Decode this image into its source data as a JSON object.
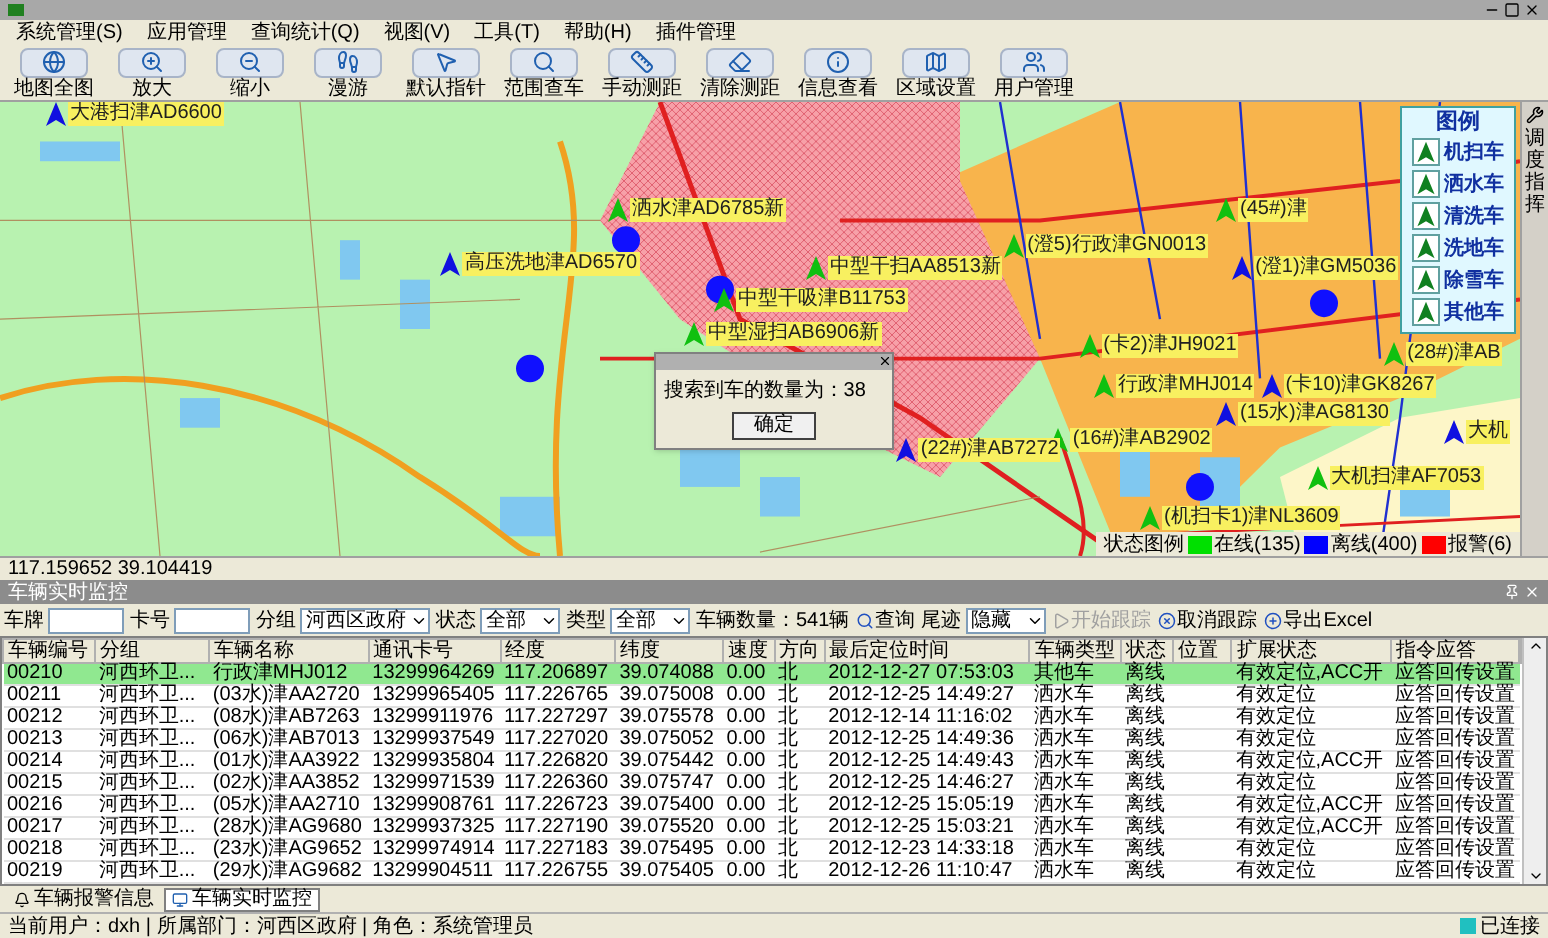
{
  "menu": [
    "系统管理(S)",
    "应用管理",
    "查询统计(Q)",
    "视图(V)",
    "工具(T)",
    "帮助(H)",
    "插件管理"
  ],
  "toolbar": [
    "地图全图",
    "放大",
    "缩小",
    "漫游",
    "默认指针",
    "范围查车",
    "手动测距",
    "清除测距",
    "信息查看",
    "区域设置",
    "用户管理"
  ],
  "map": {
    "vehicles": [
      {
        "label": "大港扫津AD6600",
        "color": "#1010e0"
      },
      {
        "label": "洒水津AD6785新",
        "color": "#10c010"
      },
      {
        "label": "(45#)津",
        "color": "#10c010"
      },
      {
        "label": "(澄5)行政津GN0013",
        "color": "#10c010"
      },
      {
        "label": "高压洗地津AD6570",
        "color": "#1010e0"
      },
      {
        "label": "中型干扫AA8513新",
        "color": "#10c010"
      },
      {
        "label": "(澄1)津GM5036",
        "color": "#1010e0"
      },
      {
        "label": "中型干吸津B11753",
        "color": "#10c010"
      },
      {
        "label": "中型湿扫AB6906新",
        "color": "#10c010"
      },
      {
        "label": "(卡2)津JH9021",
        "color": "#10c010"
      },
      {
        "label": "(28#)津AB",
        "color": "#10c010"
      },
      {
        "label": "行政津MHJ014",
        "color": "#10c010"
      },
      {
        "label": "(卡10)津GK8267",
        "color": "#1010e0"
      },
      {
        "label": "(15水)津AG8130",
        "color": "#1010e0"
      },
      {
        "label": "大机",
        "color": "#1010e0"
      },
      {
        "label": "(16#)津AB2902",
        "color": "#10c010"
      },
      {
        "label": "(22#)津AB7272",
        "color": "#1010e0"
      },
      {
        "label": "大机扫津AF7053",
        "color": "#10c010"
      },
      {
        "label": "(机扫卡1)津NL3609",
        "color": "#10c010"
      }
    ],
    "legend": {
      "title": "图例",
      "items": [
        "机扫车",
        "洒水车",
        "清洗车",
        "洗地车",
        "除雪车",
        "其他车"
      ]
    },
    "dialog": {
      "message": "搜索到车的数量为：38",
      "button": "确定"
    },
    "status_legend": {
      "label": "状态图例",
      "items": [
        {
          "label": "在线(135)",
          "color": "#00e000"
        },
        {
          "label": "离线(400)",
          "color": "#0000ff"
        },
        {
          "label": "报警(6)",
          "color": "#ff0000"
        }
      ]
    }
  },
  "side_tab": "调度指挥",
  "coordinates": "117.159652 39.104419",
  "monitor": {
    "title": "车辆实时监控",
    "filters": [
      {
        "kind": "input",
        "label": "车牌"
      },
      {
        "kind": "input",
        "label": "卡号"
      },
      {
        "kind": "select",
        "label": "分组",
        "value": "河西区政府"
      },
      {
        "kind": "select",
        "label": "状态",
        "value": "全部"
      },
      {
        "kind": "select",
        "label": "类型",
        "value": "全部"
      },
      {
        "kind": "text",
        "label": "车辆数量：541辆"
      },
      {
        "kind": "button",
        "label": "查询",
        "disabled": false
      },
      {
        "kind": "select",
        "label": "尾迹",
        "value": "隐藏"
      },
      {
        "kind": "button",
        "label": "开始跟踪",
        "disabled": true
      },
      {
        "kind": "button",
        "label": "取消跟踪",
        "disabled": false
      },
      {
        "kind": "button",
        "label": "导出Excel",
        "disabled": false
      }
    ],
    "columns": [
      "车辆编号",
      "分组",
      "车辆名称",
      "通讯卡号",
      "经度",
      "纬度",
      "速度",
      "方向",
      "最后定位时间",
      "车辆类型",
      "状态",
      "位置",
      "扩展状态",
      "指令应答"
    ],
    "rows": [
      {
        "id": "00210",
        "group": "河西环卫...",
        "name": "行政津MHJ012",
        "card": "13299964269",
        "lon": "117.206897",
        "lat": "39.074088",
        "speed": "0.00",
        "dir": "北",
        "time": "2012-12-27 07:53:03",
        "type": "其他车",
        "status": "离线",
        "ext": "有效定位,ACC开",
        "ack": "应答回传设置",
        "selected": true
      },
      {
        "id": "00211",
        "group": "河西环卫...",
        "name": "(03水)津AA2720",
        "card": "13299965405",
        "lon": "117.226765",
        "lat": "39.075008",
        "speed": "0.00",
        "dir": "北",
        "time": "2012-12-25 14:49:27",
        "type": "洒水车",
        "status": "离线",
        "ext": "有效定位",
        "ack": "应答回传设置",
        "selected": false
      },
      {
        "id": "00212",
        "group": "河西环卫...",
        "name": "(08水)津AB7263",
        "card": "13299911976",
        "lon": "117.227297",
        "lat": "39.075578",
        "speed": "0.00",
        "dir": "北",
        "time": "2012-12-14 11:16:02",
        "type": "洒水车",
        "status": "离线",
        "ext": "有效定位",
        "ack": "应答回传设置",
        "selected": false
      },
      {
        "id": "00213",
        "group": "河西环卫...",
        "name": "(06水)津AB7013",
        "card": "13299937549",
        "lon": "117.227020",
        "lat": "39.075052",
        "speed": "0.00",
        "dir": "北",
        "time": "2012-12-25 14:49:36",
        "type": "洒水车",
        "status": "离线",
        "ext": "有效定位",
        "ack": "应答回传设置",
        "selected": false
      },
      {
        "id": "00214",
        "group": "河西环卫...",
        "name": "(01水)津AA3922",
        "card": "13299935804",
        "lon": "117.226820",
        "lat": "39.075442",
        "speed": "0.00",
        "dir": "北",
        "time": "2012-12-25 14:49:43",
        "type": "洒水车",
        "status": "离线",
        "ext": "有效定位,ACC开",
        "ack": "应答回传设置",
        "selected": false
      },
      {
        "id": "00215",
        "group": "河西环卫...",
        "name": "(02水)津AA3852",
        "card": "13299971539",
        "lon": "117.226360",
        "lat": "39.075747",
        "speed": "0.00",
        "dir": "北",
        "time": "2012-12-25 14:46:27",
        "type": "洒水车",
        "status": "离线",
        "ext": "有效定位",
        "ack": "应答回传设置",
        "selected": false
      },
      {
        "id": "00216",
        "group": "河西环卫...",
        "name": "(05水)津AA2710",
        "card": "13299908761",
        "lon": "117.226723",
        "lat": "39.075400",
        "speed": "0.00",
        "dir": "北",
        "time": "2012-12-25 15:05:19",
        "type": "洒水车",
        "status": "离线",
        "ext": "有效定位,ACC开",
        "ack": "应答回传设置",
        "selected": false
      },
      {
        "id": "00217",
        "group": "河西环卫...",
        "name": "(28水)津AG9680",
        "card": "13299937325",
        "lon": "117.227190",
        "lat": "39.075520",
        "speed": "0.00",
        "dir": "北",
        "time": "2012-12-25 15:03:21",
        "type": "洒水车",
        "status": "离线",
        "ext": "有效定位,ACC开",
        "ack": "应答回传设置",
        "selected": false
      },
      {
        "id": "00218",
        "group": "河西环卫...",
        "name": "(23水)津AG9652",
        "card": "13299974914",
        "lon": "117.227183",
        "lat": "39.075495",
        "speed": "0.00",
        "dir": "北",
        "time": "2012-12-23 14:33:18",
        "type": "洒水车",
        "status": "离线",
        "ext": "有效定位",
        "ack": "应答回传设置",
        "selected": false
      },
      {
        "id": "00219",
        "group": "河西环卫...",
        "name": "(29水)津AG9682",
        "card": "13299904511",
        "lon": "117.226755",
        "lat": "39.075405",
        "speed": "0.00",
        "dir": "北",
        "time": "2012-12-26 11:10:47",
        "type": "洒水车",
        "status": "离线",
        "ext": "有效定位",
        "ack": "应答回传设置",
        "selected": false
      }
    ]
  },
  "bottom_tabs": [
    {
      "label": "车辆报警信息",
      "selected": false
    },
    {
      "label": "车辆实时监控",
      "selected": true
    }
  ],
  "status_bar": {
    "user": "当前用户：dxh | 所属部门：河西区政府 | 角色：系统管理员",
    "connection": "已连接"
  }
}
